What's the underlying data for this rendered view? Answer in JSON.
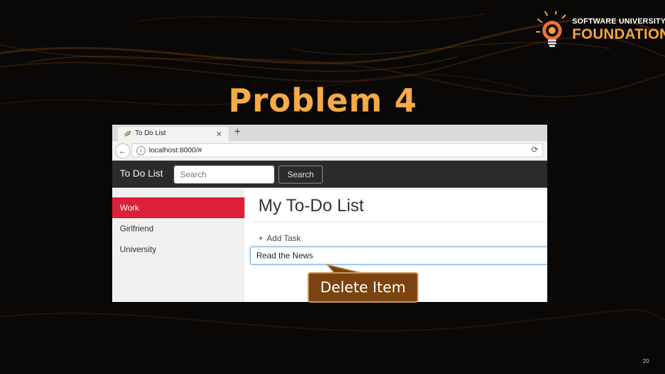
{
  "slide": {
    "title": "Problem 4",
    "page_number": "20",
    "logo": {
      "line1": "SOFTWARE UNIVERSITY",
      "line2": "FOUNDATION"
    },
    "callout": {
      "text": "Delete Item"
    },
    "colors": {
      "title": "#f4ab48",
      "logo_orange": "#f5a43a",
      "callout_bg": "#7a4310"
    }
  },
  "browser": {
    "tab": {
      "title": "To Do List",
      "favicon": "leaf-icon"
    },
    "url": "localhost:8000/#"
  },
  "app": {
    "brand": "To Do List",
    "search": {
      "placeholder": "Search",
      "button_label": "Search"
    },
    "lists": [
      {
        "label": "Work",
        "active": true
      },
      {
        "label": "Girlfriend",
        "active": false
      },
      {
        "label": "University",
        "active": false
      }
    ],
    "heading": "My To-Do List",
    "add_task_label": "Add Task",
    "task_input_value": "Read the News",
    "colors": {
      "active_item": "#dc1f3a",
      "navbar": "#2b2b2b"
    }
  }
}
